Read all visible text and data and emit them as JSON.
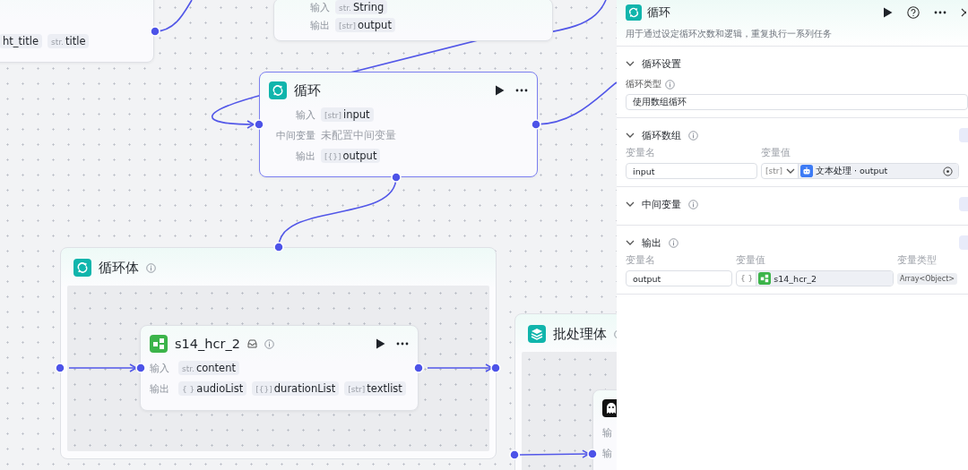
{
  "canvas": {
    "nodes": [
      {
        "selected": false,
        "rows": [
          {
            "params": [
              {
                "name": "ht_title"
              },
              {
                "type": "str.",
                "name": "title"
              }
            ]
          }
        ]
      },
      {
        "selected": false,
        "rows": [
          {
            "label": "输入",
            "params": [
              {
                "type": "str.",
                "name": "String"
              }
            ]
          },
          {
            "label": "输出",
            "params": [
              {
                "type": "[str]",
                "name": "output"
              }
            ]
          }
        ]
      },
      {
        "selected": true,
        "title": "循环",
        "rows": [
          {
            "label": "输入",
            "params": [
              {
                "type": "[str]",
                "name": "input"
              }
            ]
          },
          {
            "label": "中间变量",
            "note": "未配置中间变量"
          },
          {
            "label": "输出",
            "params": [
              {
                "type": "[{}]",
                "name": "output"
              }
            ]
          }
        ]
      }
    ],
    "groups": [
      {
        "title": "循环体",
        "node": {
          "selected": false,
          "title": "s14_hcr_2",
          "rows": [
            {
              "label": "输入",
              "params": [
                {
                  "type": "str.",
                  "name": "content"
                }
              ]
            },
            {
              "label": "输出",
              "params": [
                {
                  "type": "{ }",
                  "name": "audioList"
                },
                {
                  "type": "[{}]",
                  "name": "durationList"
                },
                {
                  "type": "[str]",
                  "name": "textlist"
                }
              ]
            }
          ]
        }
      },
      {
        "title": "批处理体",
        "node": {
          "selected": false,
          "rows": [
            {
              "label": "输"
            },
            {
              "label": "输"
            }
          ]
        }
      }
    ]
  },
  "panel": {
    "title": "循环",
    "description": "用于通过设定循环次数和逻辑，重复执行一系列任务",
    "sections": [
      {
        "kind": "select",
        "title": "循环设置",
        "label": "循环类型",
        "value": "使用数组循环"
      },
      {
        "kind": "vars",
        "title": "循环数组",
        "columns": [
          "变量名",
          "变量值"
        ],
        "rows": [
          {
            "name": "input",
            "type": "[str]",
            "dropdown": true,
            "source": "文本处理 · output"
          }
        ]
      },
      {
        "kind": "empty",
        "title": "中间变量"
      },
      {
        "kind": "vars",
        "title": "输出",
        "columns": [
          "变量名",
          "变量值",
          "变量类型"
        ],
        "rows": [
          {
            "name": "output",
            "type": "{ }",
            "dropdown": false,
            "source": "s14_hcr_2",
            "value_type": "Array<Object>"
          }
        ]
      }
    ]
  }
}
